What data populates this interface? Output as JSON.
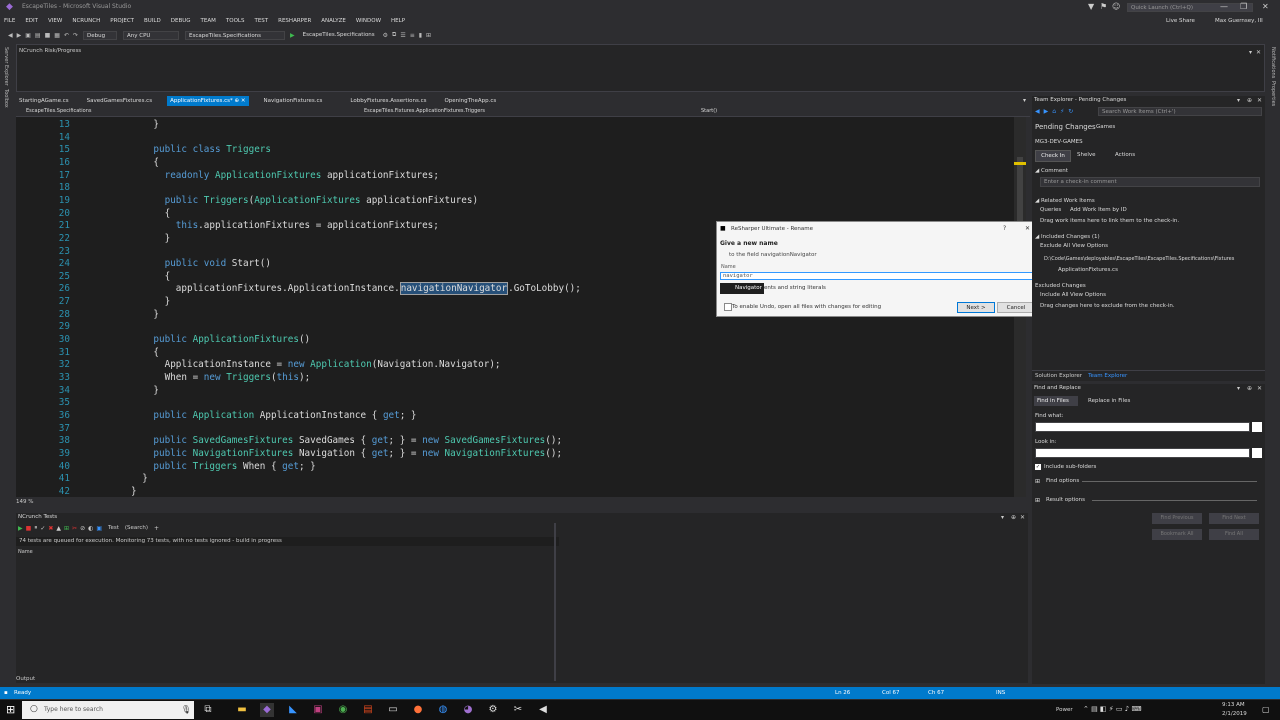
{
  "window": {
    "title": "EscapeTiles - Microsoft Visual Studio",
    "quick_launch": "Quick Launch (Ctrl+Q)",
    "live_share": "Live Share",
    "user": "Max Guernsey, III"
  },
  "menu": [
    "FILE",
    "EDIT",
    "VIEW",
    "NCRUNCH",
    "PROJECT",
    "BUILD",
    "DEBUG",
    "TEAM",
    "TOOLS",
    "TEST",
    "RESHARPER",
    "ANALYZE",
    "WINDOW",
    "HELP"
  ],
  "toolbar": {
    "config": "Debug",
    "platform": "Any CPU",
    "project": "EscapeTiles.Specifications",
    "run": "EscapeTiles.Specifications"
  },
  "side_left": [
    "Server Explorer",
    "Toolbox"
  ],
  "side_right": [
    "Notifications",
    "Properties"
  ],
  "risk_panel": {
    "title": "NCrunch Risk/Progress"
  },
  "tabs": [
    "StartingAGame.cs",
    "SavedGamesFixtures.cs",
    "ApplicationFixtures.cs*",
    "NavigationFixtures.cs",
    "LobbyFixtures.Assertions.cs",
    "OpeningTheApp.cs"
  ],
  "nav": {
    "project": "EscapeTiles.Specifications",
    "type": "EscapeTiles.Fixtures.ApplicationFixtures.Triggers",
    "member": "Start()"
  },
  "code_lines": [
    {
      "n": "13",
      "t": "    }"
    },
    {
      "n": "14",
      "t": ""
    },
    {
      "n": "15",
      "t": "    public class Triggers"
    },
    {
      "n": "16",
      "t": "    {"
    },
    {
      "n": "17",
      "t": "      readonly ApplicationFixtures applicationFixtures;"
    },
    {
      "n": "18",
      "t": ""
    },
    {
      "n": "19",
      "t": "      public Triggers(ApplicationFixtures applicationFixtures)"
    },
    {
      "n": "20",
      "t": "      {"
    },
    {
      "n": "21",
      "t": "        this.applicationFixtures = applicationFixtures;"
    },
    {
      "n": "22",
      "t": "      }"
    },
    {
      "n": "23",
      "t": ""
    },
    {
      "n": "24",
      "t": "      public void Start()"
    },
    {
      "n": "25",
      "t": "      {"
    },
    {
      "n": "26",
      "t": "        applicationFixtures.ApplicationInstance.navigationNavigator.GoToLobby();"
    },
    {
      "n": "27",
      "t": "      }"
    },
    {
      "n": "28",
      "t": "    }"
    },
    {
      "n": "29",
      "t": ""
    },
    {
      "n": "30",
      "t": "    public ApplicationFixtures()"
    },
    {
      "n": "31",
      "t": "    {"
    },
    {
      "n": "32",
      "t": "      ApplicationInstance = new Application(Navigation.Navigator);"
    },
    {
      "n": "33",
      "t": "      When = new Triggers(this);"
    },
    {
      "n": "34",
      "t": "    }"
    },
    {
      "n": "35",
      "t": ""
    },
    {
      "n": "36",
      "t": "    public Application ApplicationInstance { get; }"
    },
    {
      "n": "37",
      "t": ""
    },
    {
      "n": "38",
      "t": "    public SavedGamesFixtures SavedGames { get; } = new SavedGamesFixtures();"
    },
    {
      "n": "39",
      "t": "    public NavigationFixtures Navigation { get; } = new NavigationFixtures();"
    },
    {
      "n": "40",
      "t": "    public Triggers When { get; }"
    },
    {
      "n": "41",
      "t": "  }"
    },
    {
      "n": "42",
      "t": "}"
    }
  ],
  "zoom": "149 %",
  "rename_dialog": {
    "title": "ReSharper Ultimate - Rename",
    "heading": "Give a new name",
    "subtitle": "to the field navigationNavigator",
    "name_label": "Name",
    "name_value": "navigator",
    "suggestion": "Navigator",
    "option_text": "ents and string literals",
    "checkbox_text": "To enable Undo, open all files with changes for editing",
    "next_button": "Next >",
    "cancel_button": "Cancel"
  },
  "team_explorer": {
    "pane_title": "Team Explorer - Pending Changes",
    "search_placeholder": "Search Work Items (Ctrl+')",
    "heading": "Pending Changes",
    "heading_sub": "Games",
    "server": "MG3-DEV-GAMES",
    "check_in": "Check In",
    "shelve": "Shelve",
    "actions": "Actions",
    "comment_header": "Comment",
    "comment_placeholder": "Enter a check-in comment",
    "related_header": "Related Work Items",
    "queries": "Queries",
    "add_work_item": "Add Work Item by ID",
    "drag_hint": "Drag work items here to link them to the check-in.",
    "included_header": "Included Changes (1)",
    "exclude_all": "Exclude All",
    "view_options": "View Options",
    "path": "D:\\Code\\Games\\deployables\\EscapeTiles\\EscapeTiles.Specifications\\Fixtures",
    "file": "ApplicationFixtures.cs",
    "excluded_header": "Excluded Changes",
    "include_all": "Include All",
    "excluded_hint": "Drag changes here to exclude from the check-in.",
    "tab_solution": "Solution Explorer",
    "tab_team": "Team Explorer"
  },
  "find_replace": {
    "pane_title": "Find and Replace",
    "find_in_files": "Find in Files",
    "replace_in_files": "Replace in Files",
    "find_what": "Find what:",
    "look_in": "Look in:",
    "include_sub": "Include sub-folders",
    "find_options": "Find options",
    "result_options": "Result options",
    "find_previous": "Find Previous",
    "find_next": "Find Next",
    "bookmark_all": "Bookmark All",
    "find_all": "Find All"
  },
  "tests": {
    "title": "NCrunch Tests",
    "test_label": "Test",
    "search": "(Search)",
    "status": "74 tests are queued for execution.  Monitoring 73 tests, with no tests ignored - build in progress",
    "name_header": "Name"
  },
  "output_label": "Output",
  "status_bar": {
    "state": "Ready",
    "ln": "Ln 26",
    "col": "Col 67",
    "ch": "Ch 67",
    "ins": "INS"
  },
  "taskbar": {
    "search": "Type here to search",
    "power": "Power",
    "time": "9:13 AM",
    "date": "2/1/2019"
  }
}
